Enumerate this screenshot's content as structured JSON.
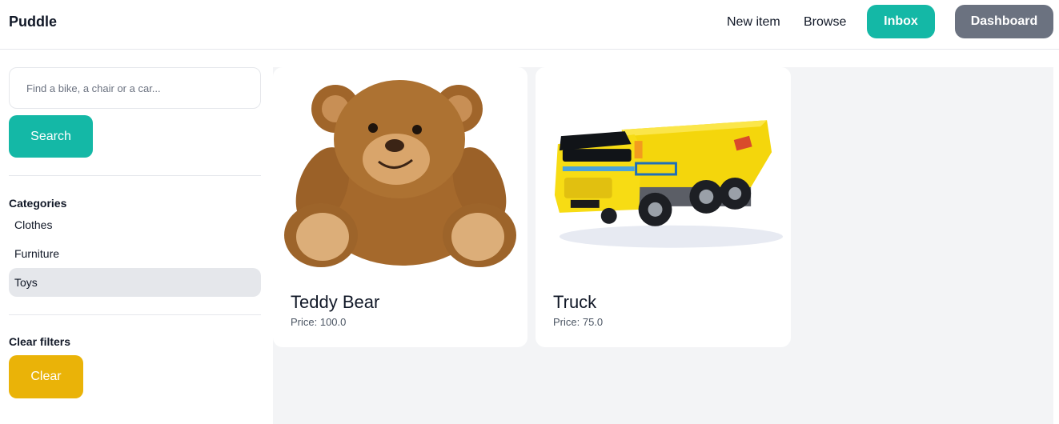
{
  "colors": {
    "teal": "#14b8a6",
    "gray_button": "#6b7280",
    "yellow_button": "#eab308",
    "selected_bg": "#e5e7eb",
    "content_bg": "#f3f4f6"
  },
  "navbar": {
    "brand": "Puddle",
    "links": [
      {
        "label": "New item"
      },
      {
        "label": "Browse"
      }
    ],
    "inbox_label": "Inbox",
    "dashboard_label": "Dashboard"
  },
  "sidebar": {
    "search": {
      "placeholder": "Find a bike, a chair or a car...",
      "value": "",
      "button_label": "Search"
    },
    "categories_title": "Categories",
    "categories": [
      {
        "label": "Clothes",
        "selected": false
      },
      {
        "label": "Furniture",
        "selected": false
      },
      {
        "label": "Toys",
        "selected": true
      }
    ],
    "clear_title": "Clear filters",
    "clear_label": "Clear"
  },
  "items": [
    {
      "name": "Teddy Bear",
      "price": "100.0",
      "price_label": "Price: ",
      "image": "teddy-bear-image"
    },
    {
      "name": "Truck",
      "price": "75.0",
      "price_label": "Price: ",
      "image": "toy-truck-image"
    }
  ]
}
